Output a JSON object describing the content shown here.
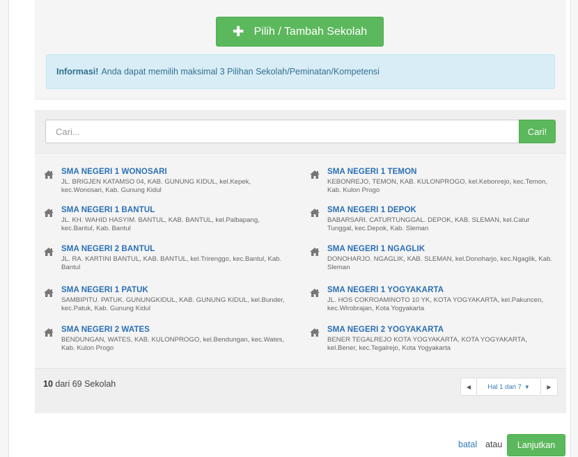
{
  "top": {
    "add_button_icon": "plus-icon",
    "add_button_label": "Pilih / Tambah Sekolah",
    "info_label": "Informasi!",
    "info_text": "Anda dapat memilih maksimal 3 Pilihan Sekolah/Peminatan/Kompetensi"
  },
  "search": {
    "placeholder": "Cari...",
    "value": "",
    "button_label": "Cari!"
  },
  "schools": [
    {
      "name": "SMA NEGERI 1 WONOSARI",
      "addr": "JL. BRIGJEN KATAMSO 04, KAB. GUNUNG KIDUL, kel.Kepek, kec.Wonosari, Kab. Gunung Kidul",
      "icon": "home-icon"
    },
    {
      "name": "SMA NEGERI 1 TEMON",
      "addr": "KEBONREJO, TEMON, KAB. KULONPROGO, kel.Kebonrejo, kec.Temon, Kab. Kulon Progo",
      "icon": "home-icon"
    },
    {
      "name": "SMA NEGERI 1 BANTUL",
      "addr": "JL. KH. WAHID HASYIM. BANTUL, KAB. BANTUL, kel.Palbapang, kec.Bantul, Kab. Bantul",
      "icon": "home-icon"
    },
    {
      "name": "SMA NEGERI 1 DEPOK",
      "addr": "BABARSARI. CATURTUNGGAL. DEPOK, KAB. SLEMAN, kel.Catur Tunggal, kec.Depok, Kab. Sleman",
      "icon": "home-icon"
    },
    {
      "name": "SMA NEGERI 2 BANTUL",
      "addr": "JL. RA. KARTINI BANTUL, KAB. BANTUL, kel.Trirenggo, kec.Bantul, Kab. Bantul",
      "icon": "home-icon"
    },
    {
      "name": "SMA NEGERI 1 NGAGLIK",
      "addr": "DONOHARJO. NGAGLIK, KAB. SLEMAN, kel.Donoharjo, kec.Ngaglik, Kab. Sleman",
      "icon": "home-icon"
    },
    {
      "name": "SMA NEGERI 1 PATUK",
      "addr": "SAMBIPITU. PATUK. GUNUNGKIDUL, KAB. GUNUNG KIDUL, kel.Bunder, kec.Patuk, Kab. Gunung Kidul",
      "icon": "home-icon"
    },
    {
      "name": "SMA NEGERI 1 YOGYAKARTA",
      "addr": "JL. HOS COKROAMINOTO 10 YK, KOTA YOGYAKARTA, kel.Pakuncen, kec.Wirobrajan, Kota Yogyakarta",
      "icon": "home-icon"
    },
    {
      "name": "SMA NEGERI 2 WATES",
      "addr": "BENDUNGAN, WATES, KAB. KULONPROGO, kel.Bendungan, kec.Wates, Kab. Kulon Progo",
      "icon": "home-icon"
    },
    {
      "name": "SMA NEGERI 2 YOGYAKARTA",
      "addr": "BENER TEGALREJO KOTA YOGYAKARTA, KOTA YOGYAKARTA, kel.Bener, kec.Tegalrejo, Kota Yogyakarta",
      "icon": "home-icon"
    }
  ],
  "footer": {
    "count_shown": "10",
    "count_text": "dari 69 Sekolah",
    "pager_prev_icon": "chevron-left-icon",
    "pager_page_label": "Hal 1 dari 7",
    "pager_caret_icon": "caret-down-icon",
    "pager_next_icon": "chevron-right-icon"
  },
  "actions": {
    "cancel_label": "batal",
    "or_label": "atau",
    "continue_label": "Lanjutkan"
  },
  "colors": {
    "success": "#5cb85c",
    "info_bg": "#d9edf7",
    "info_text": "#31708f",
    "link": "#2a6fb5"
  }
}
